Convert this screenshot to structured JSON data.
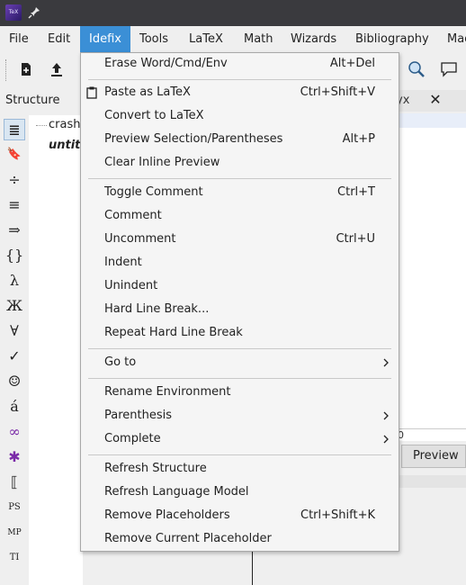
{
  "window": {
    "app_icon_text": "TeX"
  },
  "menubar": {
    "items": [
      {
        "label": "File"
      },
      {
        "label": "Edit"
      },
      {
        "label": "Idefix"
      },
      {
        "label": "Tools"
      },
      {
        "label": "LaTeX"
      },
      {
        "label": "Math"
      },
      {
        "label": "Wizards"
      },
      {
        "label": "Bibliography"
      },
      {
        "label": "Mac"
      }
    ]
  },
  "structure": {
    "title": "Structure",
    "tree": [
      {
        "label": "crash"
      },
      {
        "label": "untit"
      }
    ],
    "side_icons": [
      "≣",
      "🔖",
      "÷",
      "≡",
      "⇒",
      "{}",
      "λ",
      "Ж",
      "∀",
      "✓",
      "☺",
      "á",
      "∞",
      "✱",
      "⟦",
      "PS",
      "MP",
      "TI"
    ]
  },
  "editor": {
    "tab_label": "yx",
    "ruler_text": "0",
    "preview_label": "Preview"
  },
  "dropdown": {
    "items": [
      {
        "label": "Erase Word/Cmd/Env",
        "shortcut": "Alt+Del"
      },
      {
        "label": "Paste as LaTeX",
        "shortcut": "Ctrl+Shift+V",
        "icon": "clipboard-icon"
      },
      {
        "label": "Convert to LaTeX",
        "shortcut": ""
      },
      {
        "label": "Preview Selection/Parentheses",
        "shortcut": "Alt+P"
      },
      {
        "label": "Clear Inline Preview",
        "shortcut": ""
      },
      {
        "label": "Toggle Comment",
        "shortcut": "Ctrl+T"
      },
      {
        "label": "Comment",
        "shortcut": ""
      },
      {
        "label": "Uncomment",
        "shortcut": "Ctrl+U"
      },
      {
        "label": "Indent",
        "shortcut": ""
      },
      {
        "label": "Unindent",
        "shortcut": ""
      },
      {
        "label": "Hard Line Break...",
        "shortcut": ""
      },
      {
        "label": "Repeat Hard Line Break",
        "shortcut": ""
      },
      {
        "label": "Go to",
        "shortcut": "",
        "submenu": true
      },
      {
        "label": "Rename Environment",
        "shortcut": ""
      },
      {
        "label": "Parenthesis",
        "shortcut": "",
        "submenu": true
      },
      {
        "label": "Complete",
        "shortcut": "",
        "submenu": true
      },
      {
        "label": "Refresh Structure",
        "shortcut": ""
      },
      {
        "label": "Refresh Language Model",
        "shortcut": ""
      },
      {
        "label": "Remove Placeholders",
        "shortcut": "Ctrl+Shift+K"
      },
      {
        "label": "Remove Current Placeholder",
        "shortcut": ""
      }
    ]
  },
  "colors": {
    "accent": "#3b8fd6",
    "titlebar": "#3a3a3e",
    "menu_bg": "#f5f5f5"
  }
}
